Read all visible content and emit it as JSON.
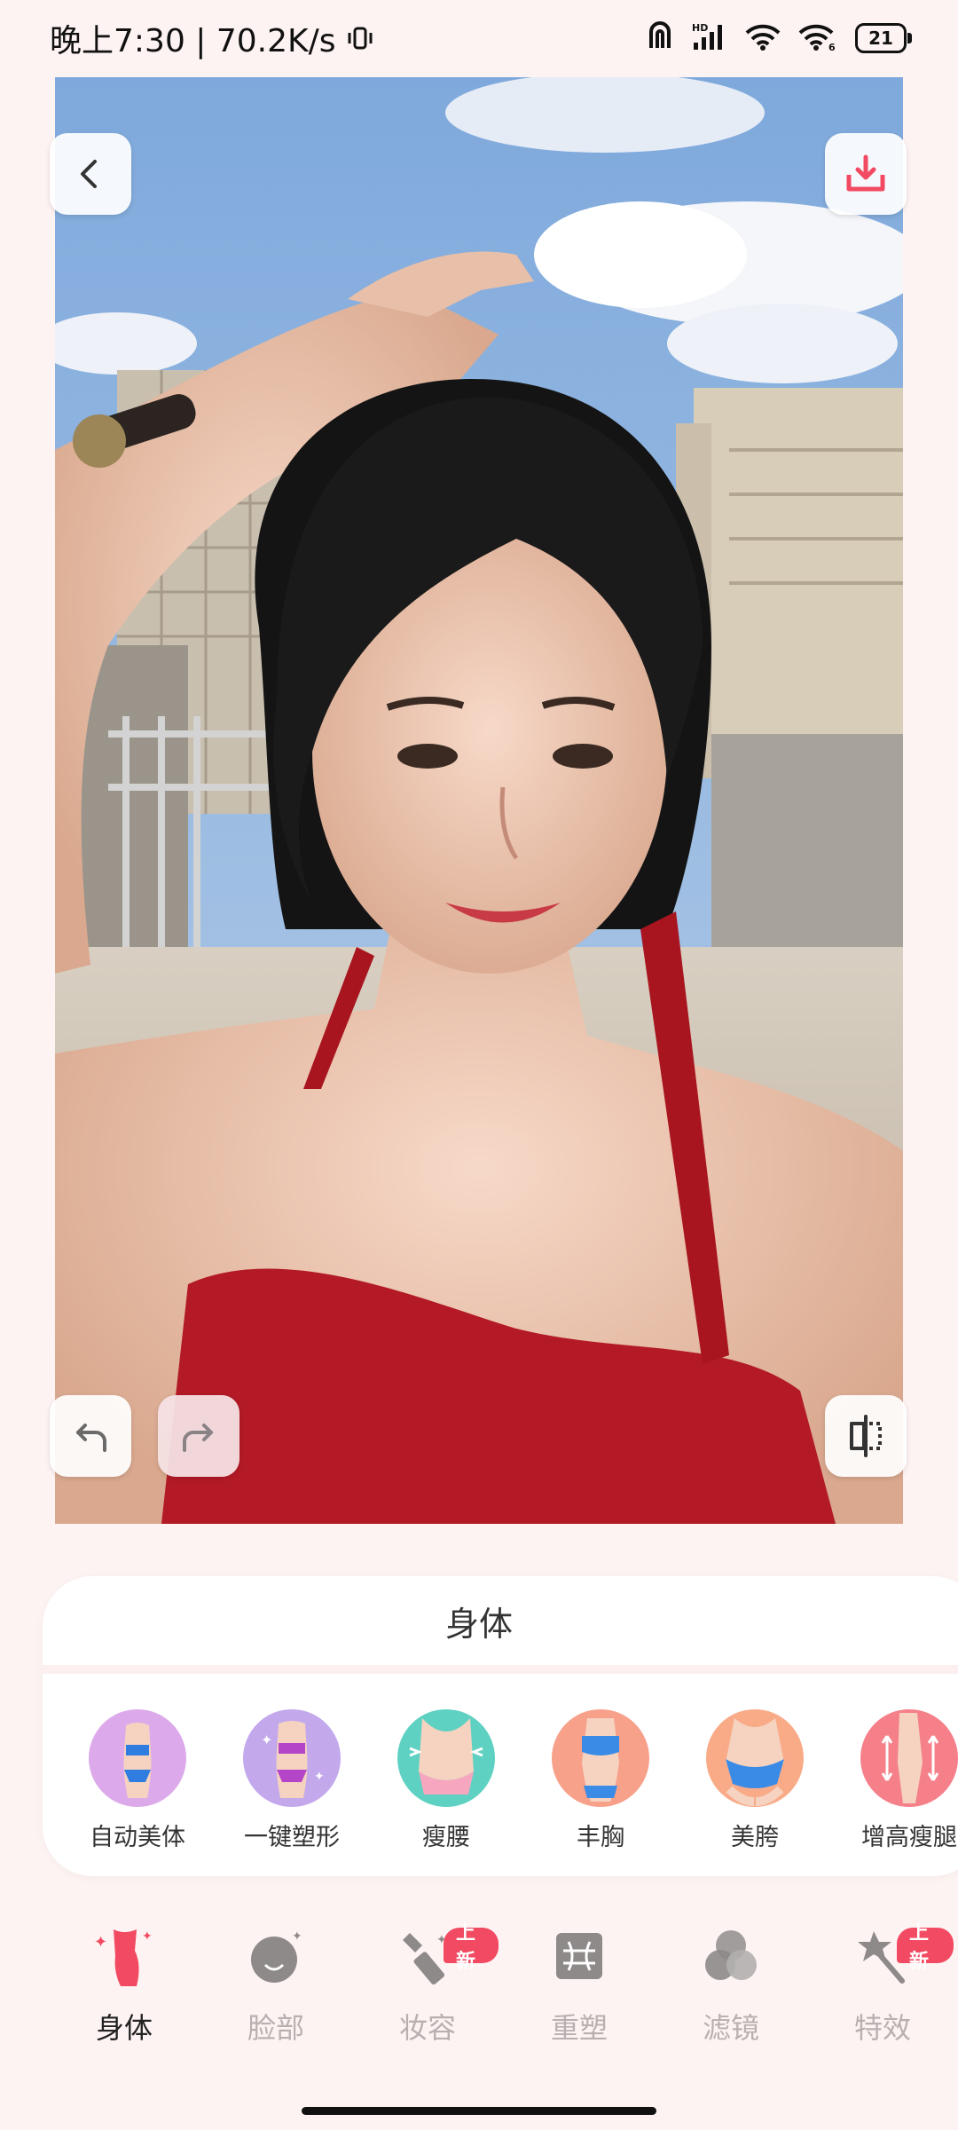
{
  "status_bar": {
    "time_and_speed": "晚上7:30 | 70.2K/s",
    "battery_level": "21",
    "icons": [
      "vibrate-icon",
      "nfc-icon",
      "hd-signal-icon",
      "wifi-icon",
      "wifi-6-icon",
      "battery-icon"
    ]
  },
  "photo": {
    "description_icons": [
      "back-icon",
      "download-icon",
      "undo-icon",
      "redo-icon",
      "compare-icon"
    ]
  },
  "panel": {
    "title": "身体",
    "tools": [
      {
        "label": "自动美体",
        "icon": "auto-body-icon",
        "color": "#d9a4e6"
      },
      {
        "label": "一键塑形",
        "icon": "one-click-shape-icon",
        "color": "#c3a3e8"
      },
      {
        "label": "瘦腰",
        "icon": "slim-waist-icon",
        "color": "#5ed1c2"
      },
      {
        "label": "丰胸",
        "icon": "bust-icon",
        "color": "#f7a08a"
      },
      {
        "label": "美胯",
        "icon": "hip-icon",
        "color": "#f9ab88"
      },
      {
        "label": "增高瘦腿",
        "icon": "taller-legs-icon",
        "color": "#f5808a"
      }
    ]
  },
  "nav": {
    "items": [
      {
        "label": "身体",
        "icon": "body-icon",
        "active": true
      },
      {
        "label": "脸部",
        "icon": "face-icon",
        "active": false
      },
      {
        "label": "妆容",
        "icon": "makeup-icon",
        "active": false,
        "badge": "上新"
      },
      {
        "label": "重塑",
        "icon": "reshape-icon",
        "active": false
      },
      {
        "label": "滤镜",
        "icon": "filter-icon",
        "active": false
      },
      {
        "label": "特效",
        "icon": "effects-icon",
        "active": false,
        "badge": "上新"
      }
    ]
  },
  "colors": {
    "accent": "#f24a62",
    "background": "#fdf3f2",
    "inactive_nav": "#b8b0b0"
  }
}
